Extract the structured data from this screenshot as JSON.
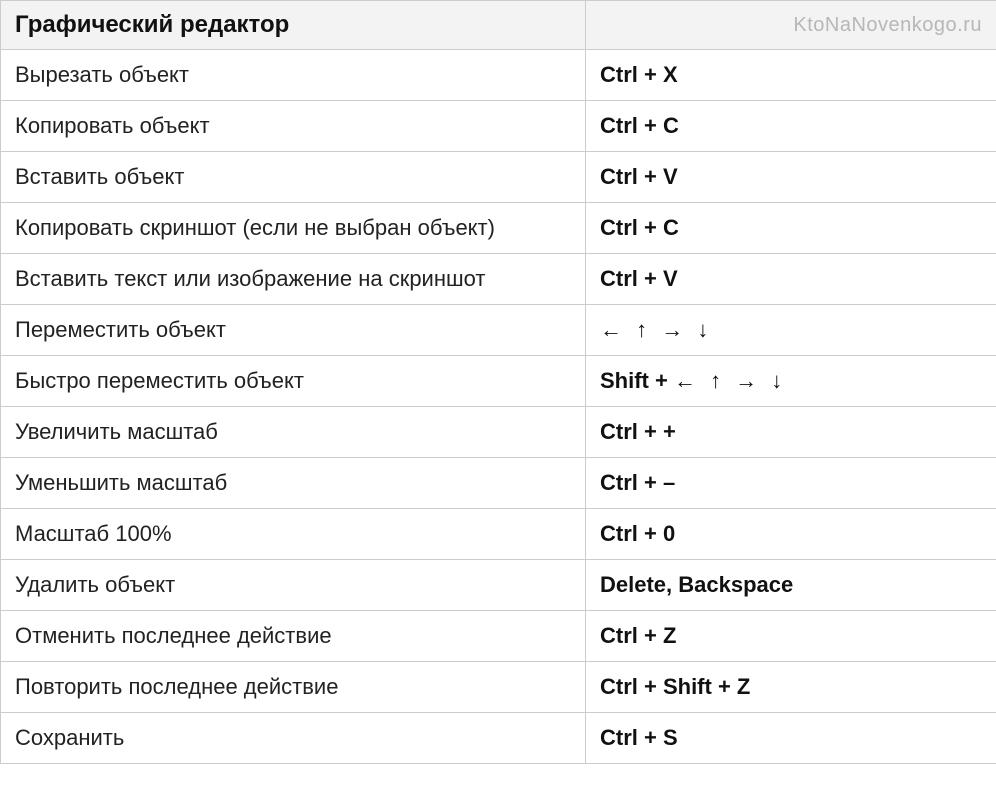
{
  "header": {
    "title": "Графический редактор",
    "watermark": "KtoNaNovenkogo.ru"
  },
  "shortcuts": [
    {
      "action": "Вырезать объект",
      "keys_bold": "Ctrl + X",
      "keys_plain": ""
    },
    {
      "action": "Копировать объект",
      "keys_bold": "Ctrl + C",
      "keys_plain": ""
    },
    {
      "action": "Вставить объект",
      "keys_bold": "Ctrl + V",
      "keys_plain": ""
    },
    {
      "action": "Копировать скриншот (если не выбран объект)",
      "keys_bold": "Ctrl + C",
      "keys_plain": ""
    },
    {
      "action": "Вставить текст или изображение на скриншот",
      "keys_bold": "Ctrl + V",
      "keys_plain": ""
    },
    {
      "action": "Переместить объект",
      "keys_bold": "",
      "keys_plain": "← ↑ → ↓"
    },
    {
      "action": "Быстро переместить объект",
      "keys_bold": "Shift + ",
      "keys_plain": "← ↑ → ↓"
    },
    {
      "action": "Увеличить масштаб",
      "keys_bold": "Ctrl + +",
      "keys_plain": ""
    },
    {
      "action": "Уменьшить масштаб",
      "keys_bold": "Ctrl + –",
      "keys_plain": ""
    },
    {
      "action": "Масштаб 100%",
      "keys_bold": "Ctrl + 0",
      "keys_plain": ""
    },
    {
      "action": "Удалить объект",
      "keys_bold": "Delete, Backspace",
      "keys_plain": ""
    },
    {
      "action": "Отменить последнее действие",
      "keys_bold": "Ctrl + Z",
      "keys_plain": ""
    },
    {
      "action": "Повторить последнее действие",
      "keys_bold": "Ctrl + Shift + Z",
      "keys_plain": ""
    },
    {
      "action": "Сохранить",
      "keys_bold": "Ctrl + S",
      "keys_plain": ""
    }
  ]
}
